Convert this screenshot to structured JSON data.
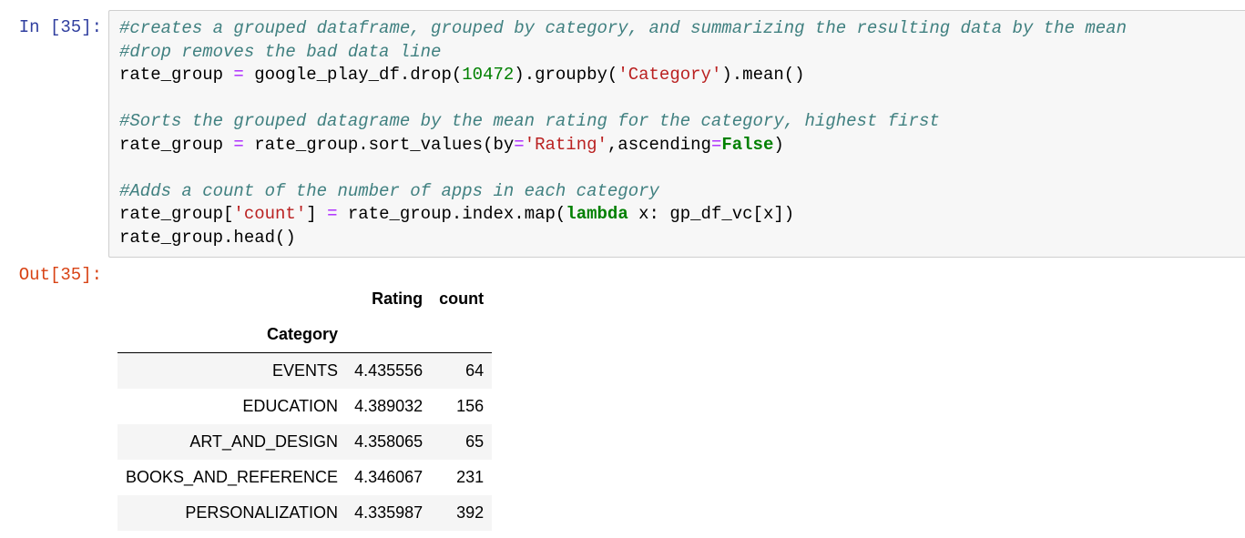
{
  "cell": {
    "in_prompt": "In [35]:",
    "out_prompt": "Out[35]:",
    "code_lines": [
      [
        {
          "t": "#creates a grouped dataframe, grouped by category, and summarizing the resulting data by the mean",
          "c": "cm"
        }
      ],
      [
        {
          "t": "#drop removes the bad data line",
          "c": "cm"
        }
      ],
      [
        {
          "t": "rate_group "
        },
        {
          "t": "=",
          "c": "op"
        },
        {
          "t": " google_play_df.drop("
        },
        {
          "t": "10472",
          "c": "num"
        },
        {
          "t": ").groupby("
        },
        {
          "t": "'Category'",
          "c": "str"
        },
        {
          "t": ").mean()"
        }
      ],
      [],
      [
        {
          "t": "#Sorts the grouped datagrame by the mean rating for the category, highest first",
          "c": "cm"
        }
      ],
      [
        {
          "t": "rate_group "
        },
        {
          "t": "=",
          "c": "op"
        },
        {
          "t": " rate_group.sort_values(by"
        },
        {
          "t": "=",
          "c": "op"
        },
        {
          "t": "'Rating'",
          "c": "str"
        },
        {
          "t": ",ascending"
        },
        {
          "t": "=",
          "c": "op"
        },
        {
          "t": "False",
          "c": "kw"
        },
        {
          "t": ")"
        }
      ],
      [],
      [
        {
          "t": "#Adds a count of the number of apps in each category",
          "c": "cm"
        }
      ],
      [
        {
          "t": "rate_group["
        },
        {
          "t": "'count'",
          "c": "str"
        },
        {
          "t": "] "
        },
        {
          "t": "=",
          "c": "op"
        },
        {
          "t": " rate_group.index.map("
        },
        {
          "t": "lambda",
          "c": "kw"
        },
        {
          "t": " x: gp_df_vc[x])"
        }
      ],
      [
        {
          "t": "rate_group.head()"
        }
      ]
    ]
  },
  "dataframe": {
    "columns": [
      "Rating",
      "count"
    ],
    "index_name": "Category",
    "rows": [
      {
        "category": "EVENTS",
        "rating": "4.435556",
        "count": "64"
      },
      {
        "category": "EDUCATION",
        "rating": "4.389032",
        "count": "156"
      },
      {
        "category": "ART_AND_DESIGN",
        "rating": "4.358065",
        "count": "65"
      },
      {
        "category": "BOOKS_AND_REFERENCE",
        "rating": "4.346067",
        "count": "231"
      },
      {
        "category": "PERSONALIZATION",
        "rating": "4.335987",
        "count": "392"
      }
    ]
  }
}
